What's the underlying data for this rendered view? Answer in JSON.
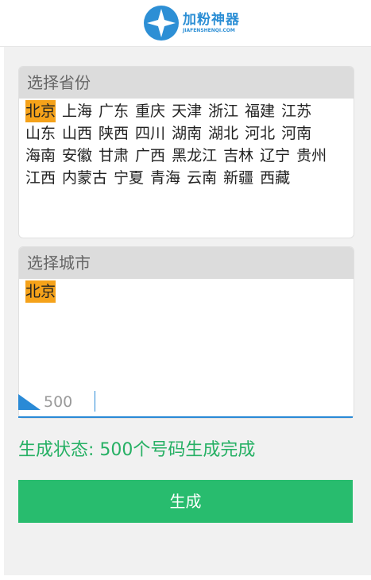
{
  "header": {
    "logo_text": "加粉神器",
    "logo_subtext": "JIAFENSHENQI.COM"
  },
  "province_panel": {
    "title": "选择省份",
    "selected": "北京",
    "items": [
      "北京",
      "上海",
      "广东",
      "重庆",
      "天津",
      "浙江",
      "福建",
      "江苏",
      "山东",
      "山西",
      "陕西",
      "四川",
      "湖南",
      "湖北",
      "河北",
      "河南",
      "海南",
      "安徽",
      "甘肃",
      "广西",
      "黑龙江",
      "吉林",
      "辽宁",
      "贵州",
      "江西",
      "内蒙古",
      "宁夏",
      "青海",
      "云南",
      "新疆",
      "西藏"
    ]
  },
  "city_panel": {
    "title": "选择城市",
    "selected": "北京",
    "items": [
      "北京"
    ]
  },
  "count_input": {
    "value": "500"
  },
  "status_text": "生成状态: 500个号码生成完成",
  "generate_button": {
    "label": "生成"
  },
  "colors": {
    "selected_chip": "#f5a21a",
    "accent_blue": "#2a8ad6",
    "status_green": "#26b064",
    "button_green": "#28bc6e"
  }
}
